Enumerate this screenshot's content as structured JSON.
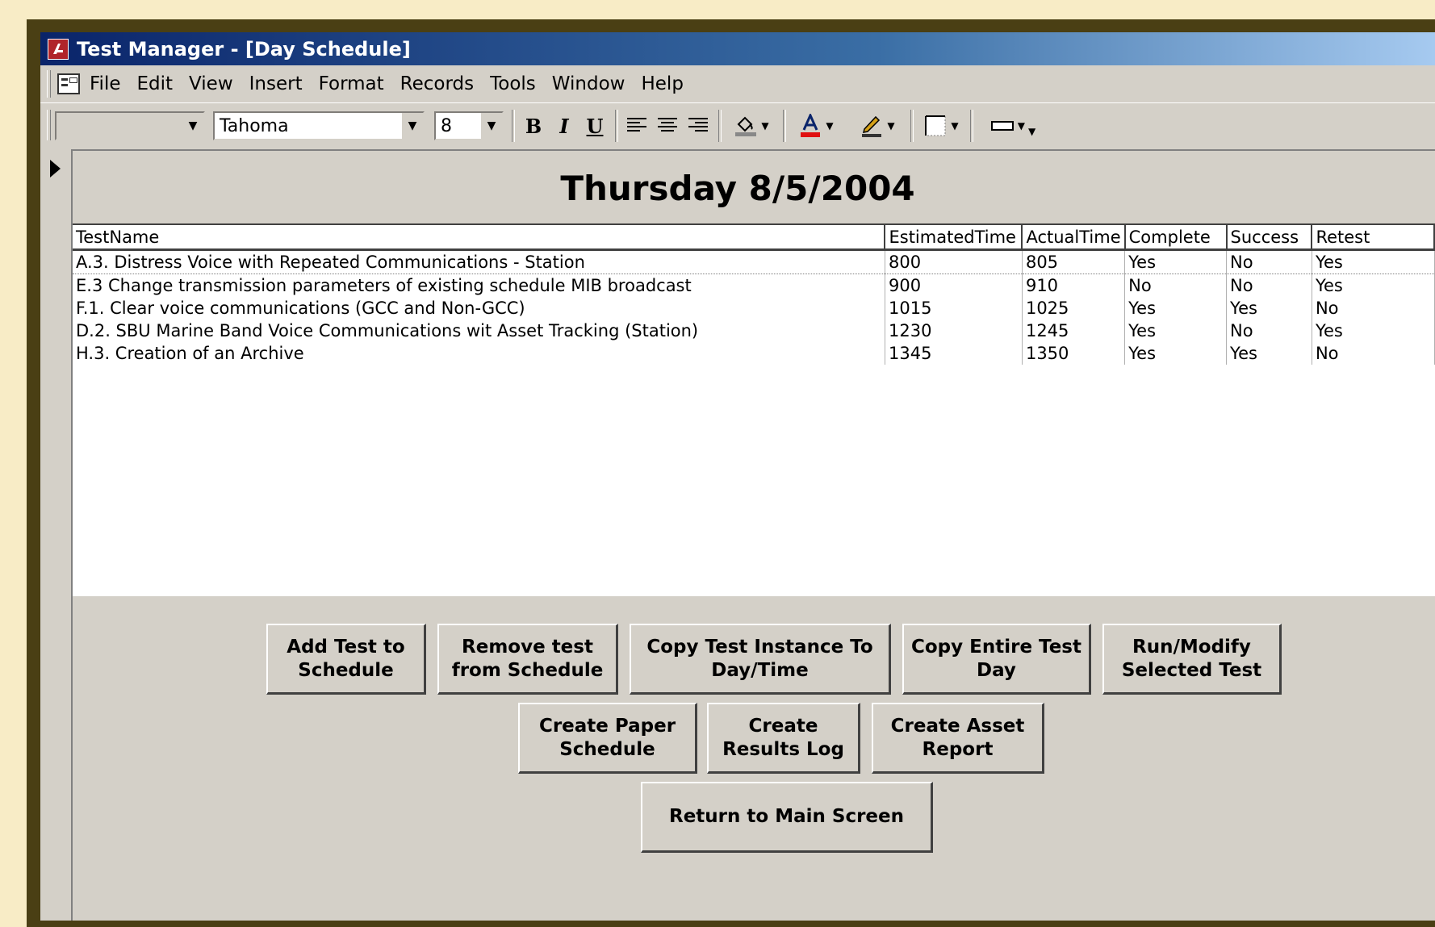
{
  "window": {
    "title": "Test Manager - [Day Schedule]"
  },
  "menu": [
    "File",
    "Edit",
    "View",
    "Insert",
    "Format",
    "Records",
    "Tools",
    "Window",
    "Help"
  ],
  "toolbar": {
    "object_combo_value": "",
    "font_name": "Tahoma",
    "font_size": "8",
    "bold_label": "B",
    "italic_label": "I",
    "underline_label": "U"
  },
  "form": {
    "heading": "Thursday 8/5/2004",
    "columns": [
      "TestName",
      "EstimatedTime",
      "ActualTime",
      "Complete",
      "Success",
      "Retest"
    ],
    "rows": [
      [
        "A.3.  Distress Voice with Repeated Communications - Station",
        "800",
        "805",
        "Yes",
        "No",
        "Yes"
      ],
      [
        "E.3  Change transmission parameters of existing schedule MIB broadcast",
        "900",
        "910",
        "No",
        "No",
        "Yes"
      ],
      [
        "F.1.  Clear voice communications (GCC and Non-GCC)",
        "1015",
        "1025",
        "Yes",
        "Yes",
        "No"
      ],
      [
        "D.2.  SBU Marine Band Voice Communications wit Asset Tracking (Station)",
        "1230",
        "1245",
        "Yes",
        "No",
        "Yes"
      ],
      [
        "H.3.  Creation of an Archive",
        "1345",
        "1350",
        "Yes",
        "Yes",
        "No"
      ]
    ]
  },
  "buttons": {
    "add_test": "Add Test to\nSchedule",
    "remove_test": "Remove test\nfrom Schedule",
    "copy_instance": "Copy Test Instance To\nDay/Time",
    "copy_day": "Copy Entire Test\nDay",
    "run_modify": "Run/Modify\nSelected Test",
    "paper_schedule": "Create Paper\nSchedule",
    "results_log": "Create\nResults Log",
    "asset_report": "Create Asset\nReport",
    "return_main": "Return to Main Screen"
  },
  "colors": {
    "background": "#f8ecc6",
    "frame": "#4a3f14",
    "window": "#d4d0c8",
    "titlebar_start": "#0a246a",
    "titlebar_end": "#a6caf0",
    "font_color_accent": "#e01010"
  }
}
